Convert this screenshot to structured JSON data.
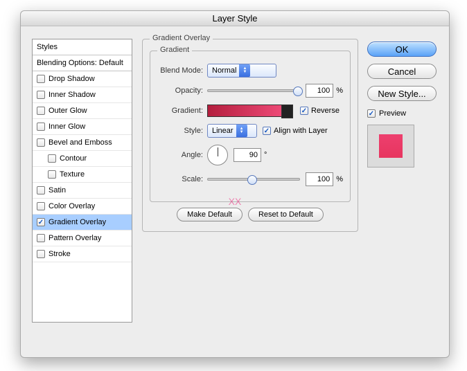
{
  "title": "Layer Style",
  "sidebar": {
    "header": "Styles",
    "subheader": "Blending Options: Default",
    "items": [
      {
        "label": "Drop Shadow",
        "checked": false,
        "indent": false
      },
      {
        "label": "Inner Shadow",
        "checked": false,
        "indent": false
      },
      {
        "label": "Outer Glow",
        "checked": false,
        "indent": false
      },
      {
        "label": "Inner Glow",
        "checked": false,
        "indent": false
      },
      {
        "label": "Bevel and Emboss",
        "checked": false,
        "indent": false
      },
      {
        "label": "Contour",
        "checked": false,
        "indent": true
      },
      {
        "label": "Texture",
        "checked": false,
        "indent": true
      },
      {
        "label": "Satin",
        "checked": false,
        "indent": false
      },
      {
        "label": "Color Overlay",
        "checked": false,
        "indent": false
      },
      {
        "label": "Gradient Overlay",
        "checked": true,
        "indent": false,
        "selected": true
      },
      {
        "label": "Pattern Overlay",
        "checked": false,
        "indent": false
      },
      {
        "label": "Stroke",
        "checked": false,
        "indent": false
      }
    ]
  },
  "main": {
    "heading": "Gradient Overlay",
    "subheading": "Gradient",
    "blend_mode_label": "Blend Mode:",
    "blend_mode_value": "Normal",
    "opacity_label": "Opacity:",
    "opacity_value": "100",
    "opacity_pct": 100,
    "gradient_label": "Gradient:",
    "reverse_label": "Reverse",
    "reverse_checked": true,
    "style_label": "Style:",
    "style_value": "Linear",
    "align_label": "Align with Layer",
    "align_checked": true,
    "angle_label": "Angle:",
    "angle_value": "90",
    "angle_degree": "°",
    "scale_label": "Scale:",
    "scale_value": "100",
    "scale_pct": 50,
    "percent": "%",
    "make_default": "Make Default",
    "reset_default": "Reset to Default"
  },
  "right": {
    "ok": "OK",
    "cancel": "Cancel",
    "new_style": "New Style...",
    "preview": "Preview",
    "preview_checked": true
  },
  "watermark": "XX"
}
